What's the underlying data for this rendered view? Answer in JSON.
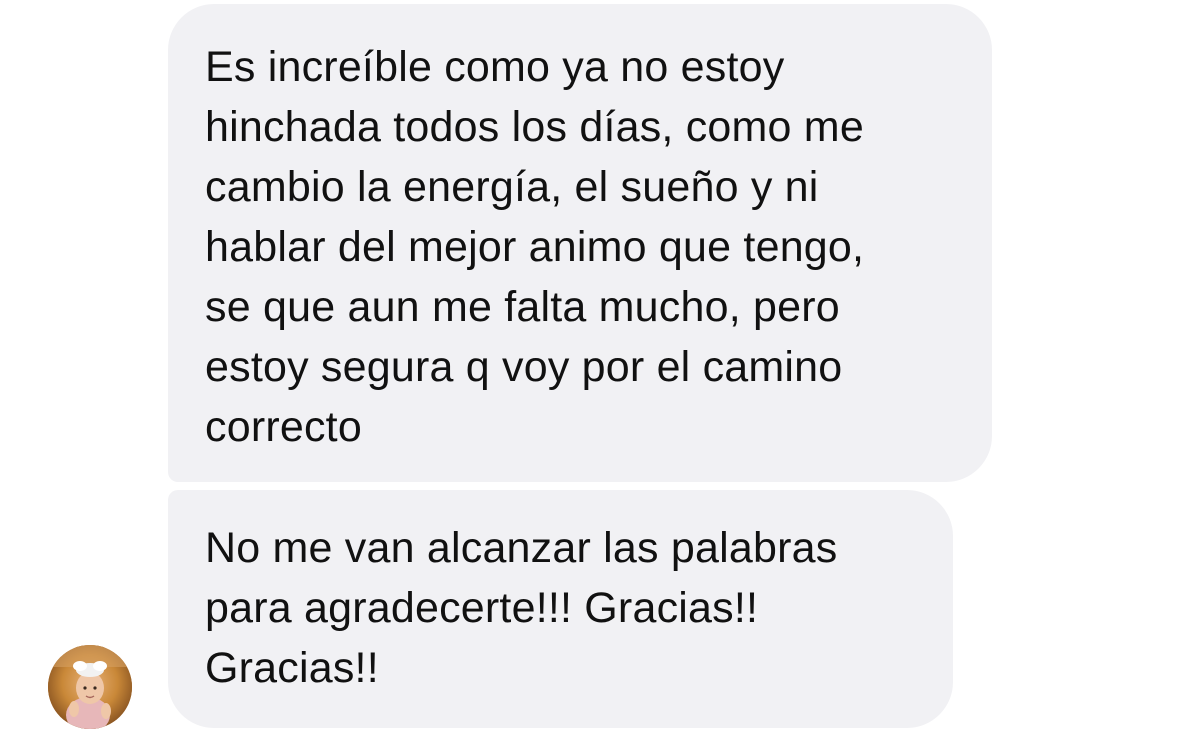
{
  "conversation": {
    "messages": [
      {
        "text": "Es increíble como ya no estoy\nhinchada todos los días, como me\ncambio la energía, el sueño y ni\nhablar del mejor animo que tengo,\nse que aun me falta mucho, pero\nestoy segura q voy por el camino\ncorrecto"
      },
      {
        "text": "No me van alcanzar las palabras\npara agradecerte!!! Gracias!!\nGracias!!"
      }
    ]
  },
  "colors": {
    "bubble_background": "#f1f1f4",
    "text": "#111111",
    "page_background": "#ffffff"
  },
  "icons": {
    "avatar": "contact-avatar-photo"
  }
}
